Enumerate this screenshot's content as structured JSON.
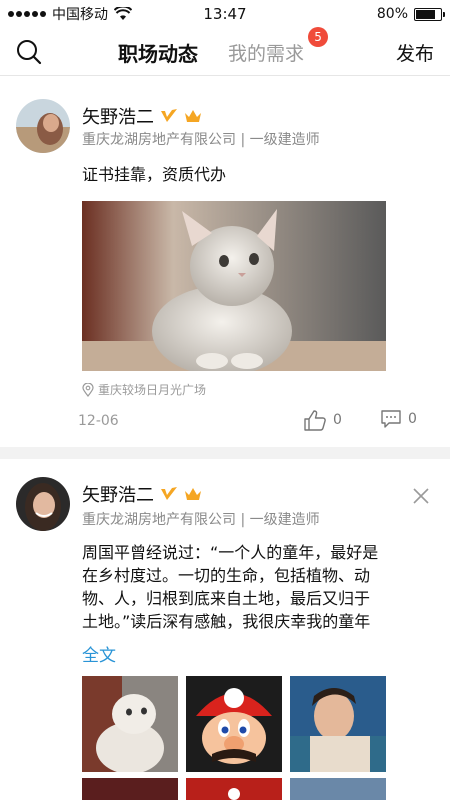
{
  "status_bar": {
    "carrier": "中国移动",
    "time": "13:47",
    "battery": "80%",
    "battery_level": 0.8
  },
  "nav": {
    "tab_active": "职场动态",
    "tab_inactive": "我的需求",
    "badge_count": "5",
    "publish": "发布"
  },
  "posts": [
    {
      "author": "矢野浩二",
      "company": "重庆龙湖房地产有限公司 | 一级建造师",
      "text": "证书挂靠，资质代办",
      "location": "重庆较场日月光广场",
      "date": "12-06",
      "likes": "0",
      "comments": "0"
    },
    {
      "author": "矢野浩二",
      "company": "重庆龙湖房地产有限公司 | 一级建造师",
      "text_lines": [
        "周国平曾经说过：“一个人的童年，最好是",
        "在乡村度过。一切的生命，包括植物、动",
        "物、人，归根到底来自土地，最后又归于",
        "土地。”读后深有感触，我很庆幸我的童年"
      ],
      "full_text_link": "全文"
    }
  ],
  "colors": {
    "link": "#2a94d6",
    "badge": "#f04b3a",
    "v_badge": "#f5a623",
    "crown": "#f5a623"
  }
}
